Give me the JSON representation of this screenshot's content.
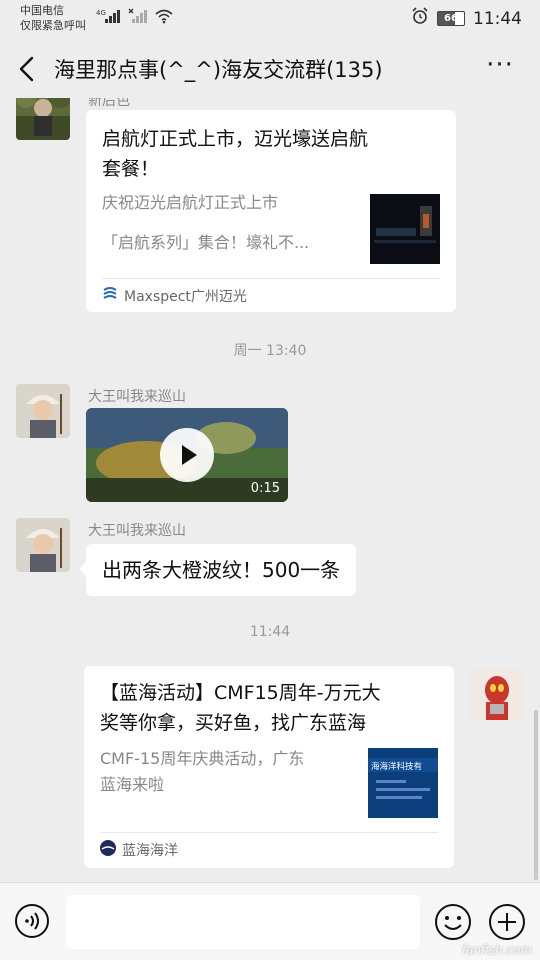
{
  "status_bar": {
    "carrier_line1": "中国电信",
    "carrier_line2": "仅限紧急呼叫",
    "network_type": "4G",
    "battery": "66",
    "time": "11:44"
  },
  "header": {
    "title": "海里那点事(^_^)海友交流群(135)",
    "more_label": "···"
  },
  "messages": {
    "card1": {
      "sender_partial": "新后色",
      "title_line1": "启航灯正式上市，迈光壕送启航",
      "title_line2": "套餐！",
      "desc_line1": "庆祝迈光启航灯正式上市",
      "desc_line2": "「启航系列」集合！壕礼不...",
      "source": "Maxspect广州迈光"
    },
    "timestamp1": "周一 13:40",
    "video_msg": {
      "sender": "大王叫我来巡山",
      "duration": "0:15"
    },
    "text_msg": {
      "sender": "大王叫我来巡山",
      "text": "出两条大橙波纹！500一条"
    },
    "timestamp2": "11:44",
    "card2": {
      "title_line1": "【蓝海活动】CMF15周年-万元大",
      "title_line2": "奖等你拿，买好鱼，找广东蓝海",
      "desc_line1": "CMF-15周年庆典活动，广东",
      "desc_line2": "蓝海来啦",
      "thumb_text": "海海洋科技有",
      "source": "蓝海海洋"
    }
  },
  "input_bar": {
    "placeholder": ""
  },
  "watermark": "fanfish.com",
  "colors": {
    "background": "#ededed",
    "bubble": "#ffffff",
    "secondary_text": "#888888"
  }
}
